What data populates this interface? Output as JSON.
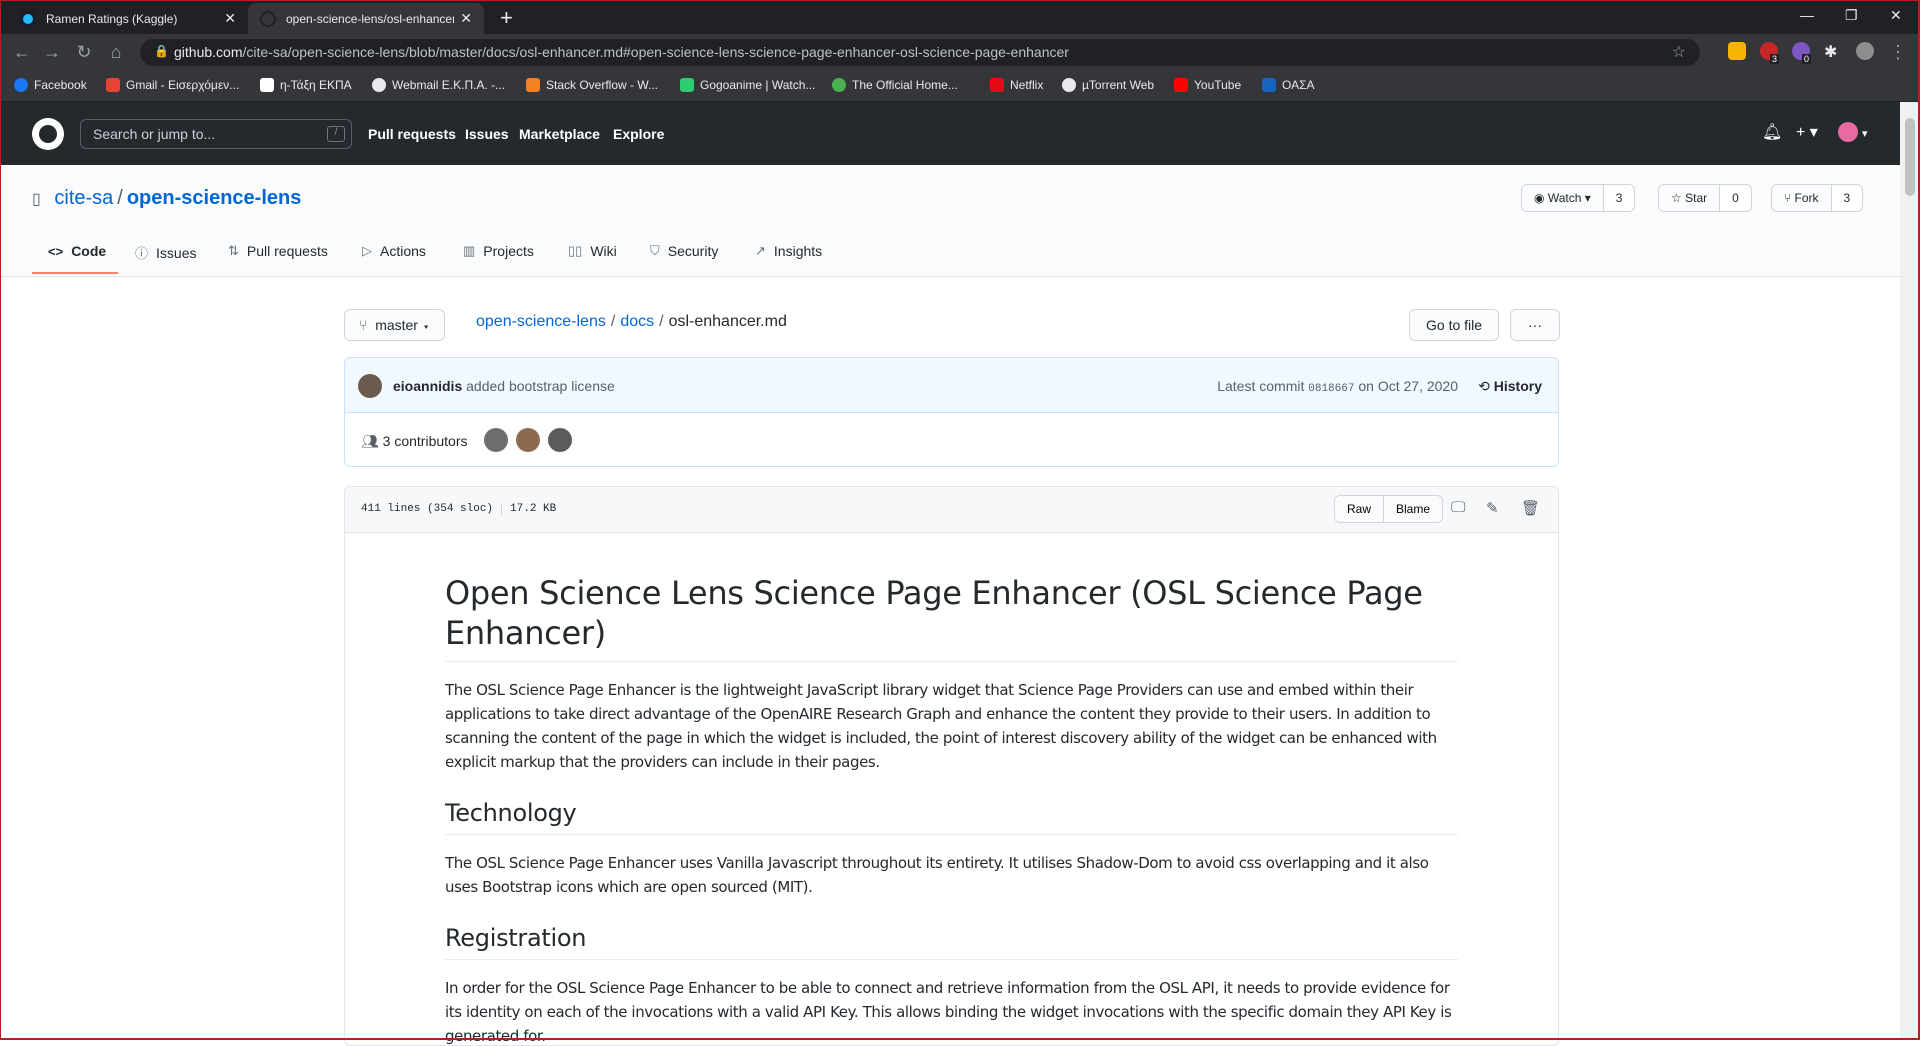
{
  "browser": {
    "tabs": [
      {
        "title": "Ramen Ratings (Kaggle)",
        "active": false
      },
      {
        "title": "open-science-lens/osl-enhancer.md at master · cite-sa/open-science-lens",
        "active": true
      }
    ],
    "url_host": "github.com",
    "url_path": "/cite-sa/open-science-lens/blob/master/docs/osl-enhancer.md#open-science-lens-science-page-enhancer-osl-science-page-enhancer",
    "bookmarks": [
      "Facebook",
      "Gmail - Εισερχόμεν...",
      "η-Τάξη ΕΚΠΑ",
      "Webmail Ε.Κ.Π.Α. -...",
      "Stack Overflow - W...",
      "Gogoanime | Watch...",
      "The Official Home...",
      "Netflix",
      "µTorrent Web",
      "YouTube",
      "ΟΑΣΑ"
    ],
    "badge_counts": [
      "3",
      "0"
    ]
  },
  "github": {
    "search_placeholder": "Search or jump to...",
    "search_key": "/",
    "nav": [
      "Pull requests",
      "Issues",
      "Marketplace",
      "Explore"
    ]
  },
  "repo": {
    "owner": "cite-sa",
    "name": "open-science-lens",
    "watch_label": "Watch",
    "watch_count": "3",
    "star_label": "Star",
    "star_count": "0",
    "fork_label": "Fork",
    "fork_count": "3",
    "tabs": [
      "Code",
      "Issues",
      "Pull requests",
      "Actions",
      "Projects",
      "Wiki",
      "Security",
      "Insights"
    ]
  },
  "file": {
    "branch": "master",
    "breadcrumb": [
      "open-science-lens",
      "docs"
    ],
    "filename": "osl-enhancer.md",
    "goto_label": "Go to file",
    "more_label": "···",
    "commit_author": "eioannidis",
    "commit_message": "added bootstrap license",
    "commit_prefix": "Latest commit",
    "commit_sha": "0818667",
    "commit_date": "on Oct 27, 2020",
    "history_label": "History",
    "contributors": "3 contributors",
    "lines": "411 lines (354 sloc)",
    "size": "17.2 KB",
    "raw_label": "Raw",
    "blame_label": "Blame"
  },
  "article": {
    "h1": "Open Science Lens Science Page Enhancer (OSL Science Page Enhancer)",
    "p1": "The OSL Science Page Enhancer is the lightweight JavaScript library widget that Science Page Providers can use and embed within their applications to take direct advantage of the OpenAIRE Research Graph and enhance the content they provide to their users. In addition to scanning the content of the page in which the widget is included, the point of interest discovery ability of the widget can be enhanced with explicit markup that the providers can include in their pages.",
    "h2a": "Technology",
    "p2": "The OSL Science Page Enhancer uses Vanilla Javascript throughout its entirety. It utilises Shadow-Dom to avoid css overlapping and it also uses Bootstrap icons which are open sourced (MIT).",
    "h2b": "Registration",
    "p3": "In order for the OSL Science Page Enhancer to be able to connect and retrieve information from the OSL API, it needs to provide evidence for its identity on each of the invocations with a valid API Key. This allows binding the widget invocations with the specific domain they API Key is generated for."
  }
}
